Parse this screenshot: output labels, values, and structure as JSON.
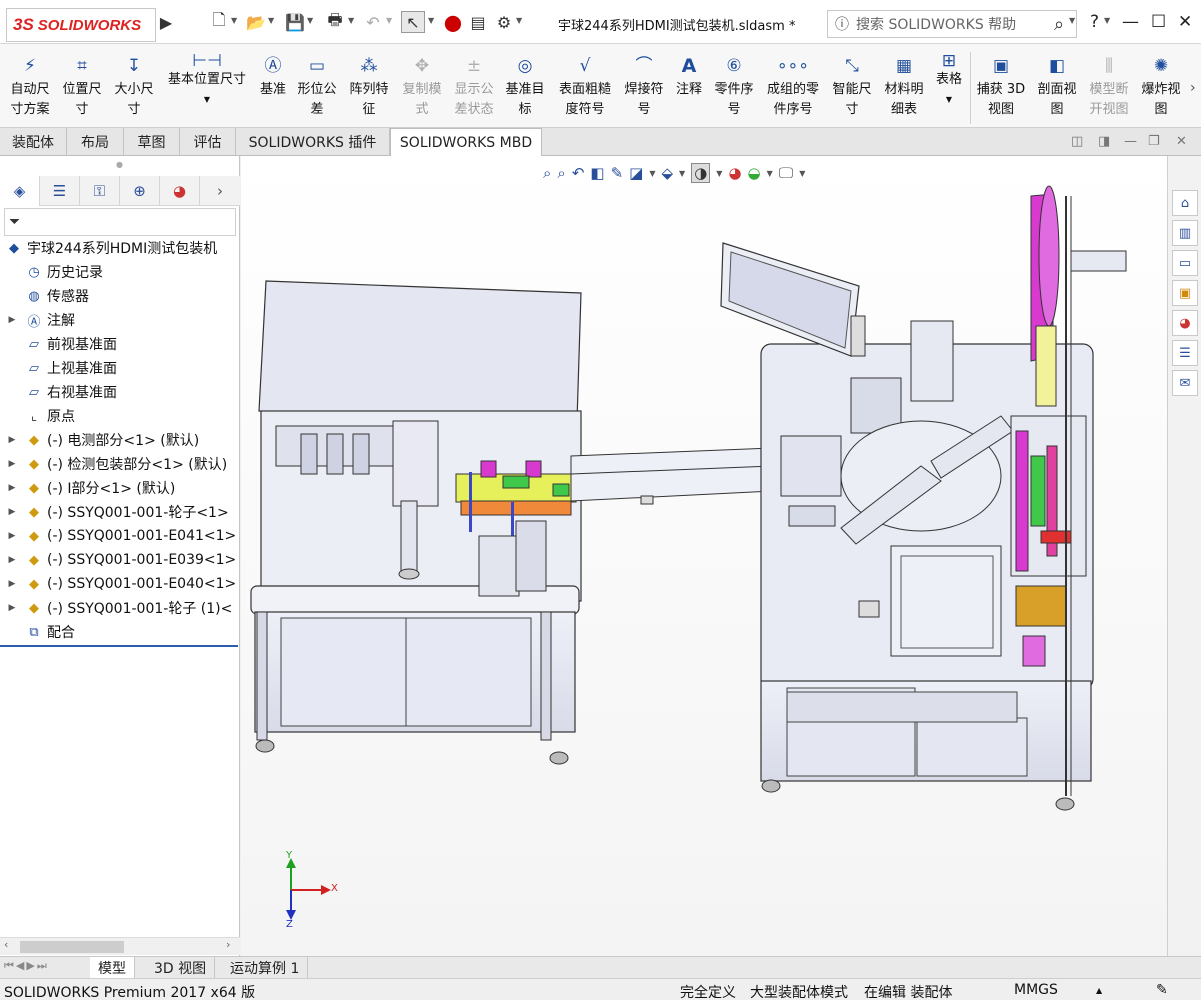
{
  "titlebar": {
    "logo_ds": "3S",
    "logo_text": "SOLIDWORKS",
    "doc_title": "宇球244系列HDMI测试包装机.sldasm *",
    "search_placeholder": "搜索 SOLIDWORKS 帮助",
    "help": "?",
    "icons": [
      "expand-arrow-icon",
      "new-file-icon",
      "open-file-icon",
      "save-icon",
      "print-icon",
      "undo-icon",
      "select-arrow-icon",
      "traffic-light-icon",
      "file-properties-icon",
      "options-gear-icon"
    ]
  },
  "ribbon": {
    "buttons": [
      {
        "line1": "自动尺",
        "line2": "寸方案",
        "icon": "auto-dimension-icon"
      },
      {
        "line1": "位置尺",
        "line2": "寸",
        "icon": "location-dimension-icon"
      },
      {
        "line1": "大小尺",
        "line2": "寸",
        "icon": "size-dimension-icon"
      },
      {
        "line1": "基本位置尺寸",
        "line2": "",
        "icon": "basic-location-dimension-icon"
      },
      {
        "line1": "基准",
        "line2": "",
        "icon": "datum-icon"
      },
      {
        "line1": "形位公",
        "line2": "差",
        "icon": "geometric-tolerance-icon"
      },
      {
        "line1": "阵列特",
        "line2": "征",
        "icon": "pattern-feature-icon"
      },
      {
        "line1": "复制模",
        "line2": "式",
        "icon": "copy-scheme-icon"
      },
      {
        "line1": "显示公",
        "line2": "差状态",
        "icon": "show-tolerance-status-icon"
      },
      {
        "line1": "基准目",
        "line2": "标",
        "icon": "datum-target-icon"
      },
      {
        "line1": "表面粗糙",
        "line2": "度符号",
        "icon": "surface-finish-icon"
      },
      {
        "line1": "焊接符",
        "line2": "号",
        "icon": "weld-symbol-icon"
      },
      {
        "line1": "注释",
        "line2": "",
        "icon": "note-icon"
      },
      {
        "line1": "零件序",
        "line2": "号",
        "icon": "balloon-icon"
      },
      {
        "line1": "成组的零",
        "line2": "件序号",
        "icon": "stacked-balloon-icon"
      },
      {
        "line1": "智能尺",
        "line2": "寸",
        "icon": "smart-dimension-icon"
      },
      {
        "line1": "材料明",
        "line2": "细表",
        "icon": "bom-icon"
      },
      {
        "line1": "表格",
        "line2": "",
        "icon": "table-icon"
      },
      {
        "line1": "捕获 3D",
        "line2": "视图",
        "icon": "capture-3d-view-icon"
      },
      {
        "line1": "剖面视",
        "line2": "图",
        "icon": "section-view-icon"
      },
      {
        "line1": "模型断",
        "line2": "开视图",
        "icon": "model-break-view-icon"
      },
      {
        "line1": "爆炸视",
        "line2": "图",
        "icon": "exploded-view-icon"
      }
    ]
  },
  "tabs": [
    "装配体",
    "布局",
    "草图",
    "评估",
    "SOLIDWORKS 插件",
    "SOLIDWORKS MBD"
  ],
  "panel": {
    "tab_icons": [
      "feature-manager-icon",
      "property-manager-icon",
      "configuration-manager-icon",
      "dimxpert-manager-icon",
      "display-manager-icon"
    ],
    "filter_icon": "filter-icon",
    "tree": [
      {
        "label": "宇球244系列HDMI测试包装机",
        "icon": "assembly-icon",
        "exp": false,
        "indent": 0
      },
      {
        "label": "历史记录",
        "icon": "history-icon",
        "exp": false,
        "indent": 1
      },
      {
        "label": "传感器",
        "icon": "sensor-icon",
        "exp": false,
        "indent": 1
      },
      {
        "label": "注解",
        "icon": "annotation-icon",
        "exp": true,
        "indent": 1
      },
      {
        "label": "前视基准面",
        "icon": "plane-icon",
        "exp": false,
        "indent": 1
      },
      {
        "label": "上视基准面",
        "icon": "plane-icon",
        "exp": false,
        "indent": 1
      },
      {
        "label": "右视基准面",
        "icon": "plane-icon",
        "exp": false,
        "indent": 1
      },
      {
        "label": "原点",
        "icon": "origin-icon",
        "exp": false,
        "indent": 1
      },
      {
        "label": "(-) 电测部分<1> (默认)",
        "icon": "subassembly-icon",
        "exp": true,
        "indent": 1
      },
      {
        "label": "(-) 检测包装部分<1> (默认)",
        "icon": "subassembly-icon",
        "exp": true,
        "indent": 1
      },
      {
        "label": "(-) I部分<1> (默认)",
        "icon": "subassembly-icon",
        "exp": true,
        "indent": 1
      },
      {
        "label": "(-) SSYQ001-001-轮子<1>",
        "icon": "subassembly-icon",
        "exp": true,
        "indent": 1
      },
      {
        "label": "(-) SSYQ001-001-E041<1>",
        "icon": "subassembly-icon",
        "exp": true,
        "indent": 1
      },
      {
        "label": "(-) SSYQ001-001-E039<1>",
        "icon": "subassembly-icon",
        "exp": true,
        "indent": 1
      },
      {
        "label": "(-) SSYQ001-001-E040<1>",
        "icon": "subassembly-icon",
        "exp": true,
        "indent": 1
      },
      {
        "label": "(-) SSYQ001-001-轮子 (1)<",
        "icon": "subassembly-icon",
        "exp": true,
        "indent": 1
      },
      {
        "label": "配合",
        "icon": "mates-icon",
        "exp": false,
        "indent": 1
      }
    ]
  },
  "bottom_tabs": [
    "模型",
    "3D 视图",
    "运动算例 1"
  ],
  "status": {
    "product": "SOLIDWORKS Premium 2017 x64 版",
    "definition": "完全定义",
    "mode": "大型装配体模式",
    "editing": "在编辑 装配体",
    "units": "MMGS"
  },
  "triad": {
    "x": "X",
    "y": "Y",
    "z": "Z"
  },
  "colors": {
    "accent": "#2a5fb0",
    "brand": "#d22222",
    "machine": "#e6e8f2"
  }
}
